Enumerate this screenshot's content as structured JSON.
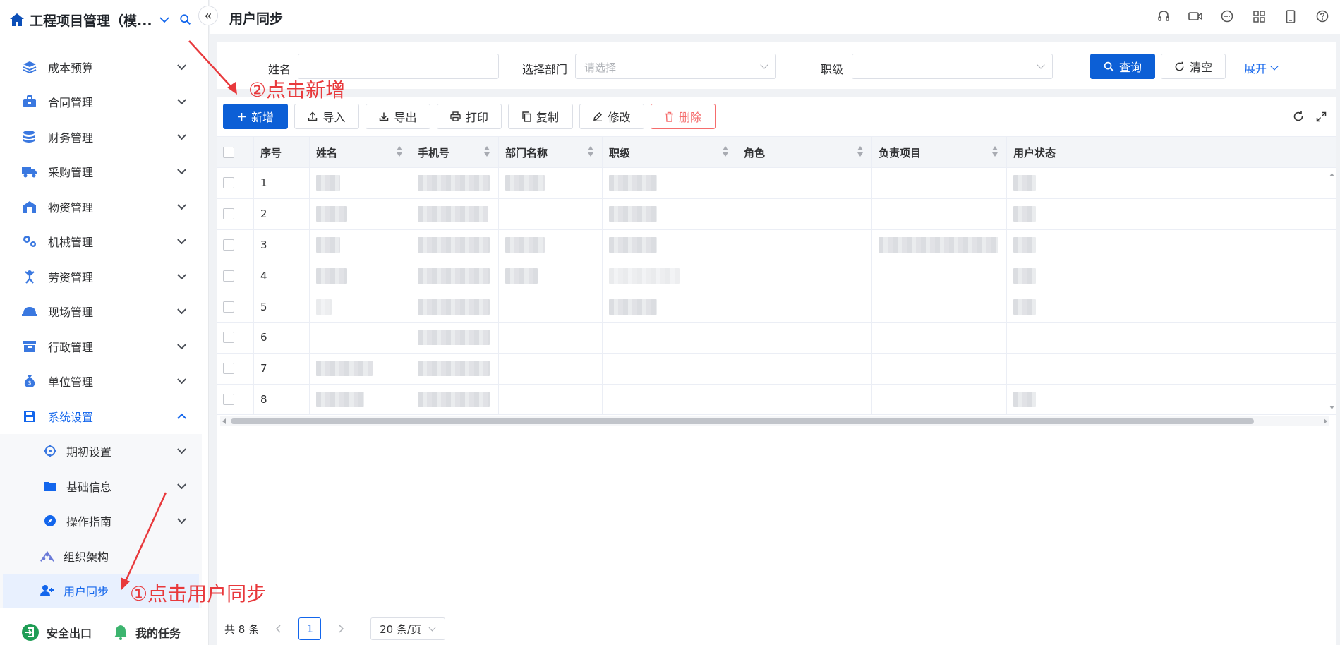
{
  "app": {
    "title": "工程项目管理（模...",
    "colors": {
      "accent": "#1366ec",
      "primary_button": "#0c5fd6",
      "danger": "#f56c6c",
      "annotation": "#e8393c"
    }
  },
  "sidebar": {
    "menu": [
      {
        "label": "成本预算",
        "icon": "layers-icon"
      },
      {
        "label": "合同管理",
        "icon": "briefcase-icon"
      },
      {
        "label": "财务管理",
        "icon": "coins-icon"
      },
      {
        "label": "采购管理",
        "icon": "truck-icon"
      },
      {
        "label": "物资管理",
        "icon": "warehouse-icon"
      },
      {
        "label": "机械管理",
        "icon": "gears-icon"
      },
      {
        "label": "劳资管理",
        "icon": "worker-icon"
      },
      {
        "label": "现场管理",
        "icon": "helmet-icon"
      },
      {
        "label": "行政管理",
        "icon": "archive-icon"
      },
      {
        "label": "单位管理",
        "icon": "money-bag-icon"
      },
      {
        "label": "系统设置",
        "icon": "save-icon"
      }
    ],
    "submenu": [
      {
        "label": "期初设置",
        "icon": "crosshair-icon"
      },
      {
        "label": "基础信息",
        "icon": "folder-icon"
      },
      {
        "label": "操作指南",
        "icon": "compass-icon"
      },
      {
        "label": "组织架构",
        "icon": "org-icon"
      },
      {
        "label": "用户同步",
        "icon": "user-plus-icon"
      }
    ],
    "footer": {
      "exit_label": "安全出口",
      "tasks_label": "我的任务"
    }
  },
  "header": {
    "page_title": "用户同步",
    "icons": [
      "headset-icon",
      "video-icon",
      "chat-icon",
      "grid-icon",
      "mobile-icon",
      "help-icon"
    ]
  },
  "search": {
    "name_label": "姓名",
    "name_value": "",
    "dept_label": "选择部门",
    "dept_placeholder": "请选择",
    "level_label": "职级",
    "level_value": "",
    "query_label": "查询",
    "clear_label": "清空",
    "expand_label": "展开"
  },
  "toolbar": {
    "add_label": "新增",
    "import_label": "导入",
    "export_label": "导出",
    "print_label": "打印",
    "copy_label": "复制",
    "edit_label": "修改",
    "delete_label": "删除"
  },
  "table": {
    "columns": [
      "序号",
      "姓名",
      "手机号",
      "部门名称",
      "职级",
      "角色",
      "负责项目",
      "用户状态"
    ],
    "rows": [
      {
        "index": "1"
      },
      {
        "index": "2"
      },
      {
        "index": "3"
      },
      {
        "index": "4"
      },
      {
        "index": "5"
      },
      {
        "index": "6"
      },
      {
        "index": "7"
      },
      {
        "index": "8"
      }
    ]
  },
  "pagination": {
    "total_label": "共 8 条",
    "current_page": "1",
    "page_size_label": "20 条/页"
  },
  "annotations": {
    "step1": "①点击用户同步",
    "step2": "②点击新增"
  }
}
